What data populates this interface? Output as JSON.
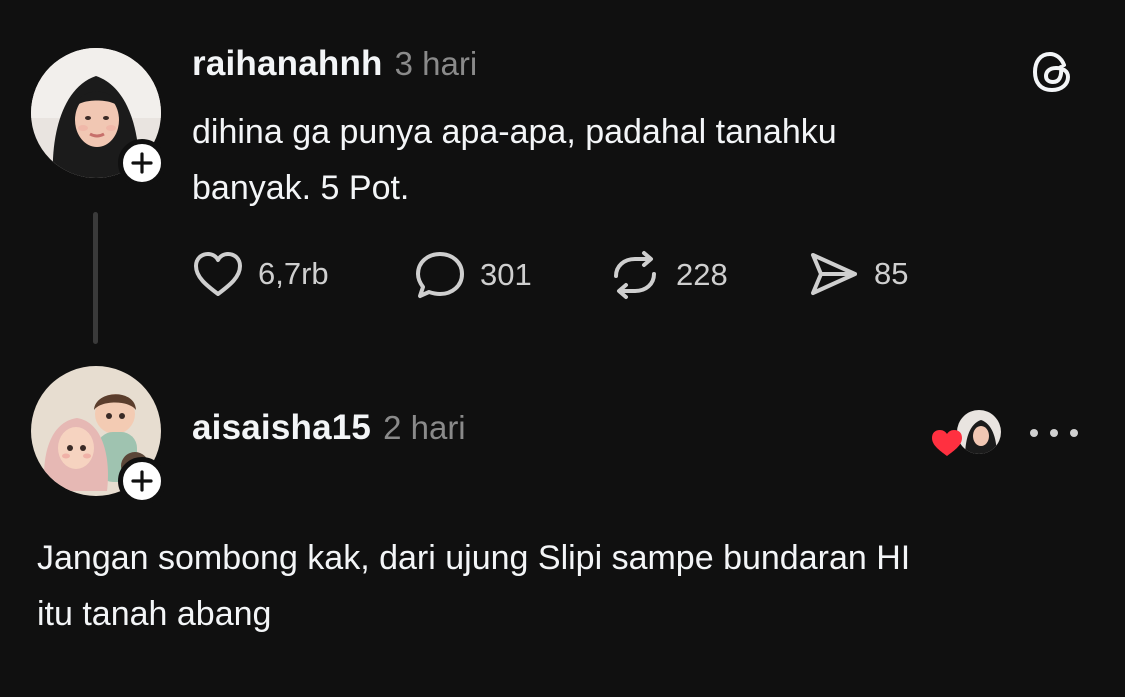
{
  "post": {
    "username": "raihanahnh",
    "time": "3 hari",
    "text_line1": "dihina ga punya apa-apa, padahal tanahku",
    "text_line2": "banyak. 5 Pot.",
    "actions": {
      "likes": "6,7rb",
      "comments": "301",
      "reposts": "228",
      "shares": "85"
    }
  },
  "reply": {
    "username": "aisaisha15",
    "time": "2 hari",
    "text_line1": "Jangan sombong kak, dari ujung Slipi sampe bundaran HI",
    "text_line2": "itu tanah abang"
  },
  "icons": {
    "logo": "threads-logo-icon",
    "like": "heart-icon",
    "comment": "comment-bubble-icon",
    "repost": "repost-icon",
    "share": "send-icon",
    "follow": "plus-icon",
    "more": "more-dots-icon",
    "liked_by_author": "heart-filled-icon"
  },
  "colors": {
    "background": "#101010",
    "text": "#f3f5f7",
    "muted": "#8a8a8a",
    "heart_red": "#ff3040"
  }
}
